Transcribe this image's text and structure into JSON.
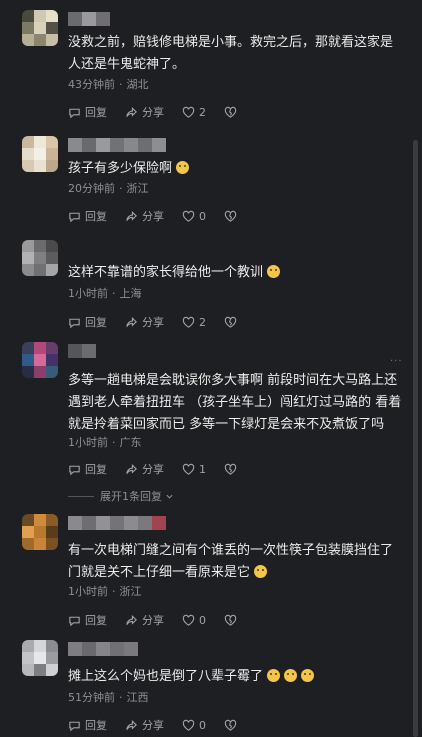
{
  "comments": [
    {
      "text": "没救之前，赔钱修电梯是小事。救完之后，那就看这家是人还是牛鬼蛇神了。",
      "time": "43分钟前",
      "location": "湖北",
      "reply_label": "回复",
      "share_label": "分享",
      "likes": "2",
      "avatar_colors": [
        "#4a4a3c",
        "#cfc9b4",
        "#e6e0c8",
        "#7c7a63",
        "#d9d1ba",
        "#545247",
        "#b7af95",
        "#8b8670",
        "#c5bfa6"
      ]
    },
    {
      "text": "孩子有多少保险啊",
      "time": "20分钟前",
      "location": "浙江",
      "reply_label": "回复",
      "share_label": "分享",
      "likes": "0",
      "avatar_colors": [
        "#c9b89f",
        "#efe7d8",
        "#d9c6a8",
        "#e6dccb",
        "#f4efe6",
        "#cbb393",
        "#d8c9b3",
        "#e9e1d2",
        "#bca88b"
      ]
    },
    {
      "text": "这样不靠谱的家长得给他一个教训",
      "time": "1小时前",
      "location": "上海",
      "reply_label": "回复",
      "share_label": "分享",
      "likes": "2",
      "avatar_colors": [
        "#9a9a9c",
        "#6b6b6e",
        "#4a4a4d",
        "#b2b2b4",
        "#808083",
        "#5c5c5f",
        "#8c8c8f",
        "#707073",
        "#a5a5a7"
      ]
    },
    {
      "text": "多等一趟电梯是会耽误你多大事啊 前段时间在大马路上还遇到老人牵着扭扭车 （孩子坐车上）闯红灯过马路的 看着就是拎着菜回家而已 多等一下绿灯是会来不及煮饭了吗",
      "time": "1小时前",
      "location": "广东",
      "reply_label": "回复",
      "share_label": "分享",
      "likes": "1",
      "avatar_colors": [
        "#3c3f5a",
        "#b04a7a",
        "#6a3c6e",
        "#2f5a8a",
        "#d56a9a",
        "#46306a",
        "#2a2c44",
        "#8a3e6c",
        "#3a5a7a"
      ],
      "expand_label": "展开1条回复"
    },
    {
      "text": "有一次电梯门缝之间有个谁丢的一次性筷子包装膜挡住了门就是关不上仔细一看原来是它",
      "time": "1小时前",
      "location": "浙江",
      "reply_label": "回复",
      "share_label": "分享",
      "likes": "0",
      "avatar_colors": [
        "#6a4a22",
        "#d08a3a",
        "#8c5a26",
        "#e1a050",
        "#b8782e",
        "#5a3c1a",
        "#9e6a2e",
        "#c8843a",
        "#7a5222"
      ]
    },
    {
      "text": "摊上这么个妈也是倒了八辈子霉了",
      "time": "51分钟前",
      "location": "江西",
      "reply_label": "回复",
      "share_label": "分享",
      "likes": "0",
      "avatar_colors": [
        "#a8aab0",
        "#d4d6da",
        "#8a8c92",
        "#c2c4c8",
        "#e6e7ea",
        "#9a9ca2",
        "#b6b8bc",
        "#7c7e84",
        "#cfd0d4"
      ]
    }
  ]
}
